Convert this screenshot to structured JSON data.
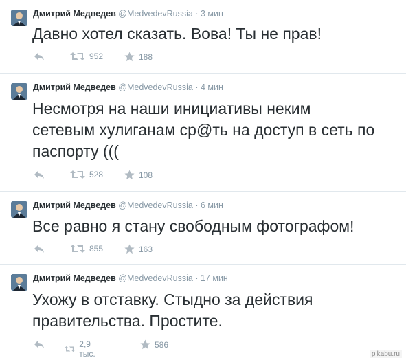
{
  "tweets": [
    {
      "author": "Дмитрий Медведев",
      "handle": "@MedvedevRussia",
      "separator": "·",
      "time": "3 мин",
      "text": "Давно хотел сказать. Вова! Ты не прав!",
      "retweets": "952",
      "favorites": "188"
    },
    {
      "author": "Дмитрий Медведев",
      "handle": "@MedvedevRussia",
      "separator": "·",
      "time": "4 мин",
      "text": "Несмотря на наши инициативы неким сетевым хулиганам ср@ть на доступ в сеть по паспорту  (((",
      "retweets": "528",
      "favorites": "108"
    },
    {
      "author": "Дмитрий Медведев",
      "handle": "@MedvedevRussia",
      "separator": "·",
      "time": "6 мин",
      "text": "Все равно я стану свободным фотографом!",
      "retweets": "855",
      "favorites": "163"
    },
    {
      "author": "Дмитрий Медведев",
      "handle": "@MedvedevRussia",
      "separator": "·",
      "time": "17 мин",
      "text": "Ухожу в отставку. Стыдно за действия правительства. Простите.",
      "retweets": "2,9 тыс.",
      "favorites": "586"
    }
  ],
  "icons": {
    "reply": "reply-icon",
    "retweet": "retweet-icon",
    "favorite": "star-icon",
    "avatar": "avatar"
  },
  "colors": {
    "text": "#292f33",
    "meta": "#8899a6",
    "divider": "#e1e8ed"
  },
  "watermark": "pikabu.ru"
}
